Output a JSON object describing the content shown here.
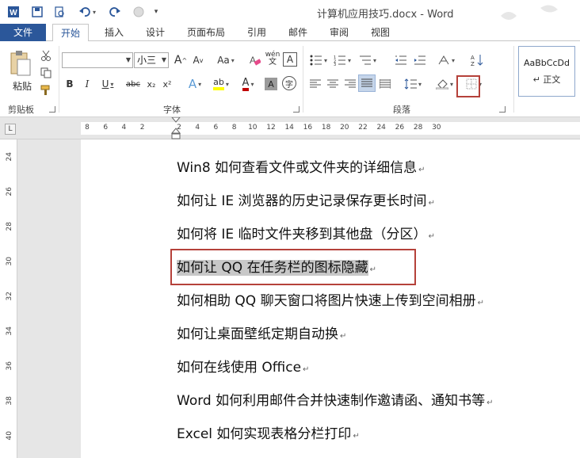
{
  "window": {
    "title": "计算机应用技巧.docx - Word"
  },
  "quick_access": {
    "undo_icon": "undo-icon",
    "redo_icon": "redo-icon",
    "save_icon": "save-icon",
    "preview_icon": "print-preview-icon"
  },
  "tabs": [
    "文件",
    "开始",
    "插入",
    "设计",
    "页面布局",
    "引用",
    "邮件",
    "审阅",
    "视图"
  ],
  "ribbon": {
    "clipboard": {
      "paste_label": "粘贴",
      "group_label": "剪贴板"
    },
    "font": {
      "name_value": "",
      "size_value": "小三",
      "grow_label": "A",
      "shrink_label": "A",
      "case_label": "Aa",
      "phonetic_label": "wén",
      "border_char_label": "A",
      "bold": "B",
      "italic": "I",
      "underline": "U",
      "strike": "abc",
      "sub": "x₂",
      "sup": "x²",
      "effects": "A",
      "highlight": "ab",
      "font_color": "A",
      "char_shade": "A",
      "enclose": "字",
      "group_label": "字体",
      "highlight_color": "#ffff00",
      "font_color_value": "#c00000"
    },
    "paragraph": {
      "group_label": "段落"
    },
    "styles": {
      "preview": "AaBbCcDd",
      "name": "↵ 正文"
    }
  },
  "ruler": {
    "corner": "L",
    "numbers": [
      "8",
      "6",
      "4",
      "2",
      "",
      "2",
      "4",
      "6",
      "8",
      "10",
      "12",
      "14",
      "16",
      "18",
      "20",
      "22",
      "24",
      "26",
      "28",
      "30"
    ],
    "vertical_numbers": [
      "24",
      "26",
      "28",
      "30",
      "32",
      "34",
      "36",
      "38",
      "40"
    ]
  },
  "document": {
    "lines": [
      "Win8 如何查看文件或文件夹的详细信息",
      "如何让 IE 浏览器的历史记录保存更长时间",
      "如何将 IE 临时文件夹移到其他盘（分区）",
      "如何让 QQ 在任务栏的图标隐藏",
      "如何相助 QQ 聊天窗口将图片快速上传到空间相册",
      "如何让桌面壁纸定期自动换",
      "如何在线使用 Office",
      "Word 如何利用邮件合并快速制作邀请函、通知书等",
      "Excel 如何实现表格分栏打印"
    ],
    "paragraph_mark": "↵",
    "selected_index": 3
  },
  "colors": {
    "accent": "#2b579a",
    "highlight_box": "#b5413a",
    "selection": "#c8c8c8"
  }
}
